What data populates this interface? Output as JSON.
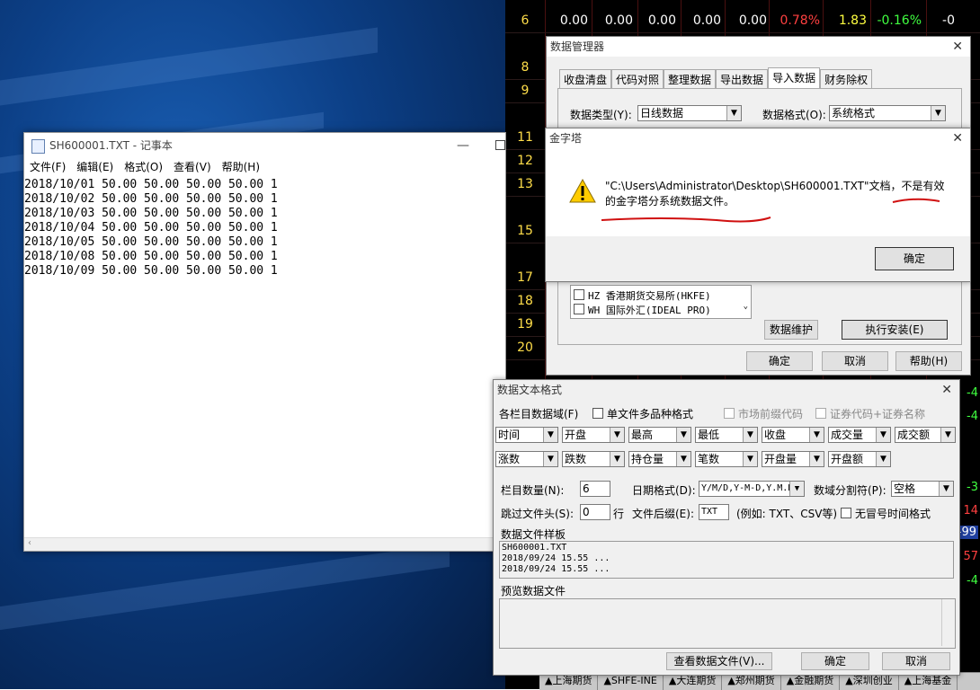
{
  "notepad": {
    "title": "SH600001.TXT - 记事本",
    "menu": [
      "文件(F)",
      "编辑(E)",
      "格式(O)",
      "查看(V)",
      "帮助(H)"
    ],
    "lines": [
      "2018/10/01 50.00 50.00 50.00 50.00 1",
      "2018/10/02 50.00 50.00 50.00 50.00 1",
      "2018/10/03 50.00 50.00 50.00 50.00 1",
      "2018/10/04 50.00 50.00 50.00 50.00 1",
      "2018/10/05 50.00 50.00 50.00 50.00 1",
      "2018/10/08 50.00 50.00 50.00 50.00 1",
      "2018/10/09 50.00 50.00 50.00 50.00 1"
    ]
  },
  "stock": {
    "top_row": [
      "0.00",
      "0.00",
      "0.00",
      "0.00",
      "0.00",
      "0.78%",
      "1.83",
      "-0.16%",
      "-0"
    ],
    "row_numbers": [
      "6",
      "8",
      "9",
      "",
      "11",
      "12",
      "13",
      "",
      "15",
      "",
      "17",
      "18",
      "19",
      "20",
      ""
    ],
    "right_values": [
      "-4",
      "-4",
      "-3",
      "14",
      "-99",
      "57",
      "-4"
    ],
    "bottom_tabs": [
      "▲上海期货",
      "▲SHFE-INE",
      "▲大连期货",
      "▲郑州期货",
      "▲金融期货",
      "▲深圳创业",
      "▲上海基金"
    ]
  },
  "data_manager": {
    "title": "数据管理器",
    "tabs": [
      "收盘清盘",
      "代码对照",
      "整理数据",
      "导出数据",
      "导入数据",
      "财务除权"
    ],
    "active_tab": "导入数据",
    "data_type_label": "数据类型(Y):",
    "data_type_value": "日线数据",
    "data_format_label": "数据格式(O):",
    "data_format_value": "系统格式",
    "markets": [
      "HZ 香港期货交易所(HKFE)",
      "WH 国际外汇(IDEAL PRO)"
    ],
    "maintain_button": "数据维护",
    "install_button": "执行安装(E)",
    "ok_button": "确定",
    "cancel_button": "取消",
    "help_button": "帮助(H)"
  },
  "alert": {
    "title": "金字塔",
    "message_line1": "\"C:\\Users\\Administrator\\Desktop\\SH600001.TXT\"文档，不是有效",
    "message_line2": "的金字塔分系统数据文件。",
    "ok_button": "确定"
  },
  "text_format": {
    "title": "数据文本格式",
    "fields_label": "各栏目数据域(F)",
    "single_file_label": "单文件多品种格式",
    "prefix_label": "市场前缀代码",
    "code_name_label": "证券代码+证券名称",
    "row1": [
      "时间",
      "开盘",
      "最高",
      "最低",
      "收盘",
      "成交量",
      "成交额"
    ],
    "row2": [
      "涨数",
      "跌数",
      "持仓量",
      "笔数",
      "开盘量",
      "开盘额"
    ],
    "col_count_label": "栏目数量(N):",
    "col_count_value": "6",
    "date_format_label": "日期格式(D):",
    "date_format_value": "Y/M/D,Y-M-D,Y.M.D",
    "separator_label": "数域分割符(P):",
    "separator_value": "空格",
    "skip_label": "跳过文件头(S):",
    "skip_value": "0",
    "skip_unit": "行",
    "suffix_label": "文件后缀(E):",
    "suffix_value": "TXT",
    "suffix_example": "(例如: TXT、CSV等)",
    "no_colon_label": "无冒号时间格式",
    "sample_label": "数据文件样板",
    "sample_lines": [
      "SH600001.TXT",
      "2018/09/24 15.55 ...",
      "2018/09/24 15.55 ..."
    ],
    "preview_label": "预览数据文件",
    "view_button": "查看数据文件(V)...",
    "ok_button": "确定",
    "cancel_button": "取消"
  }
}
